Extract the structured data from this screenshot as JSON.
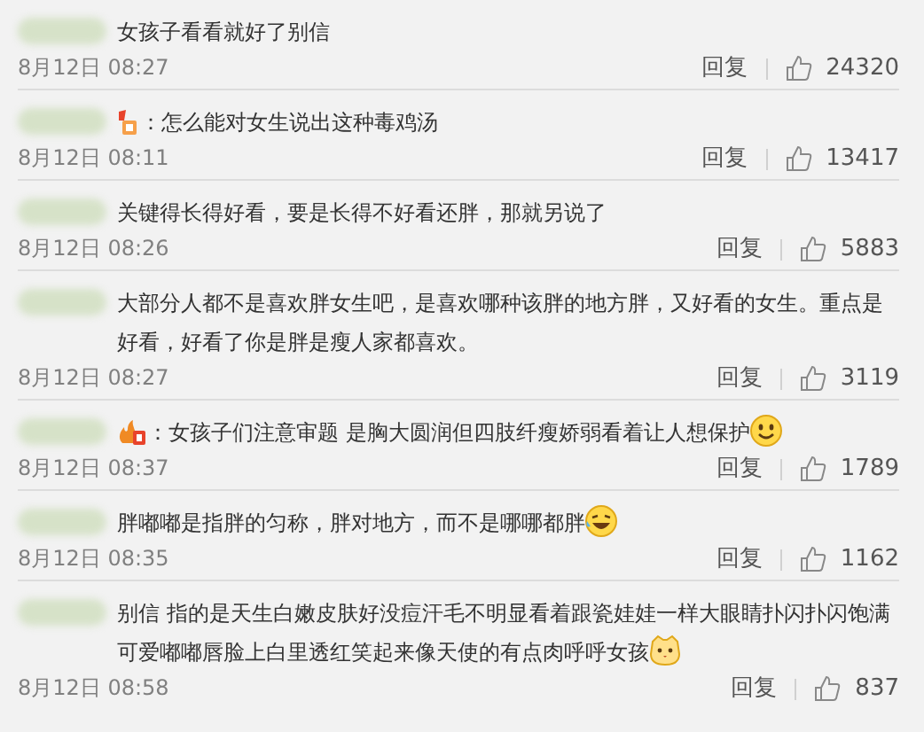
{
  "comments": [
    {
      "name_redacted": true,
      "text": "女孩子看看就好了别信",
      "time": "8月12日 08:27",
      "reply": "回复",
      "likes": "24320"
    },
    {
      "name_redacted": true,
      "badge": {
        "kind": "flag"
      },
      "text": "：怎么能对女生说出这种毒鸡汤",
      "time": "8月12日 08:11",
      "reply": "回复",
      "likes": "13417"
    },
    {
      "name_redacted": true,
      "text": "关键得长得好看，要是长得不好看还胖，那就另说了",
      "time": "8月12日 08:26",
      "reply": "回复",
      "likes": "5883"
    },
    {
      "name_redacted": true,
      "text": "大部分人都不是喜欢胖女生吧，是喜欢哪种该胖的地方胖，又好看的女生。重点是好看，好看了你是胖是瘦人家都喜欢。",
      "time": "8月12日 08:27",
      "reply": "回复",
      "likes": "3119"
    },
    {
      "name_redacted": true,
      "badge": {
        "kind": "fire"
      },
      "text": "：女孩子们注意审题 是胸大圆润但四肢纤瘦娇弱看着让人想保护",
      "emoji": {
        "kind": "smile"
      },
      "time": "8月12日 08:37",
      "reply": "回复",
      "likes": "1789"
    },
    {
      "name_redacted": true,
      "text": "胖嘟嘟是指胖的匀称，胖对地方，而不是哪哪都胖",
      "emoji": {
        "kind": "laugh-cry"
      },
      "time": "8月12日 08:35",
      "reply": "回复",
      "likes": "1162"
    },
    {
      "name_redacted": true,
      "text": "别信 指的是天生白嫩皮肤好没痘汗毛不明显看着跟瓷娃娃一样大眼睛扑闪扑闪饱满可爱嘟嘟唇脸上白里透红笑起来像天使的有点肉呼呼女孩",
      "emoji": {
        "kind": "cat"
      },
      "time": "8月12日 08:58",
      "reply": "回复",
      "likes": "837"
    }
  ]
}
